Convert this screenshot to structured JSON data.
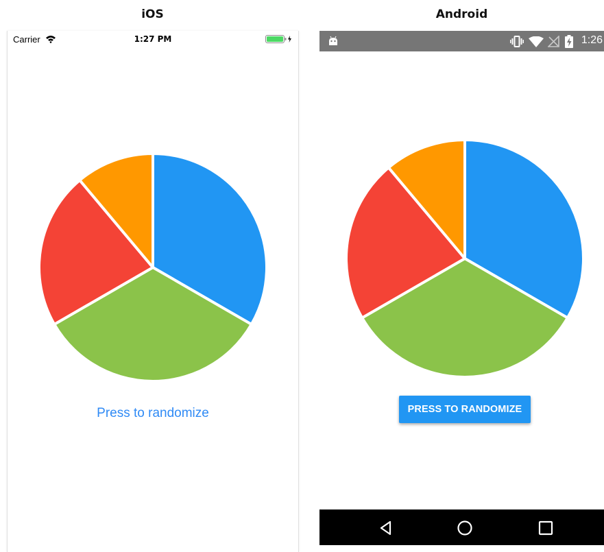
{
  "labels": {
    "ios": "iOS",
    "android": "Android"
  },
  "ios": {
    "status": {
      "carrier": "Carrier",
      "time": "1:27 PM",
      "wifi_icon": "wifi-icon",
      "battery_icon": "battery-charging-icon"
    },
    "button_label": "Press to randomize",
    "button_color": "#2f8af5"
  },
  "android": {
    "status": {
      "time": "1:26",
      "icons": [
        "android-debug-icon",
        "vibrate-icon",
        "wifi-icon",
        "no-signal-icon",
        "battery-charging-icon"
      ]
    },
    "button_label": "PRESS TO RANDOMIZE",
    "button_color": "#2196f3",
    "nav": [
      "back-icon",
      "home-icon",
      "recents-icon"
    ]
  },
  "chart_data": {
    "type": "pie",
    "slices": [
      {
        "value": 33.3,
        "color": "#2196f3"
      },
      {
        "value": 33.3,
        "color": "#8bc34a"
      },
      {
        "value": 22.2,
        "color": "#f44336"
      },
      {
        "value": 11.1,
        "color": "#ff9800"
      }
    ],
    "title": ""
  }
}
